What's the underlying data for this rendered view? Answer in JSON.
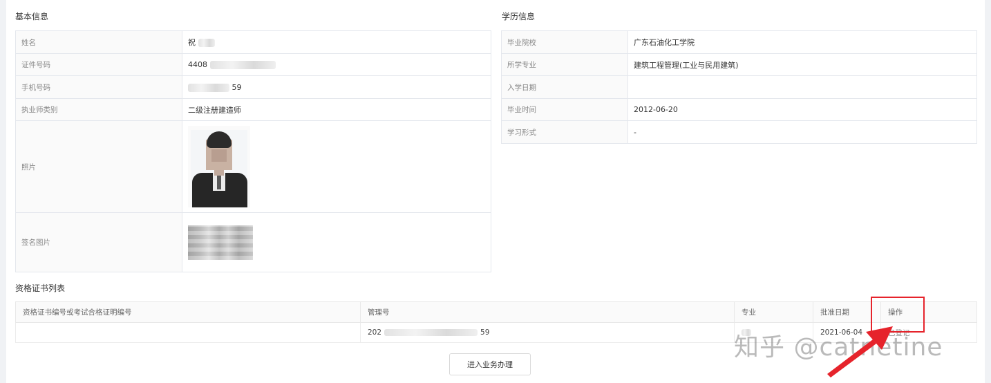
{
  "basic_info": {
    "title": "基本信息",
    "rows": [
      {
        "label": "姓名",
        "value": "祝"
      },
      {
        "label": "证件号码",
        "value": "4408"
      },
      {
        "label": "手机号码",
        "value": "59"
      },
      {
        "label": "执业师类别",
        "value": "二级注册建造师"
      },
      {
        "label": "照片",
        "value": ""
      },
      {
        "label": "签名图片",
        "value": ""
      }
    ]
  },
  "education_info": {
    "title": "学历信息",
    "rows": [
      {
        "label": "毕业院校",
        "value": "广东石油化工学院"
      },
      {
        "label": "所学专业",
        "value": "建筑工程管理(工业与民用建筑)"
      },
      {
        "label": "入学日期",
        "value": ""
      },
      {
        "label": "毕业时间",
        "value": "2012-06-20"
      },
      {
        "label": "学习形式",
        "value": "-"
      }
    ]
  },
  "cert_list": {
    "title": "资格证书列表",
    "columns": [
      "资格证书编号或考试合格证明编号",
      "管理号",
      "专业",
      "批准日期",
      "操作"
    ],
    "rows": [
      {
        "cert_no": "",
        "mgmt_no_prefix": "202",
        "mgmt_no_suffix": "59",
        "major": "",
        "approve_date": "2021-06-04",
        "action": "已登记"
      }
    ]
  },
  "action_button": {
    "label": "进入业务办理"
  },
  "watermark": {
    "text": "知乎 @catnetine"
  },
  "colors": {
    "annotation": "#e6232b",
    "border": "#e4e7ed",
    "label_bg": "#fafafa"
  }
}
